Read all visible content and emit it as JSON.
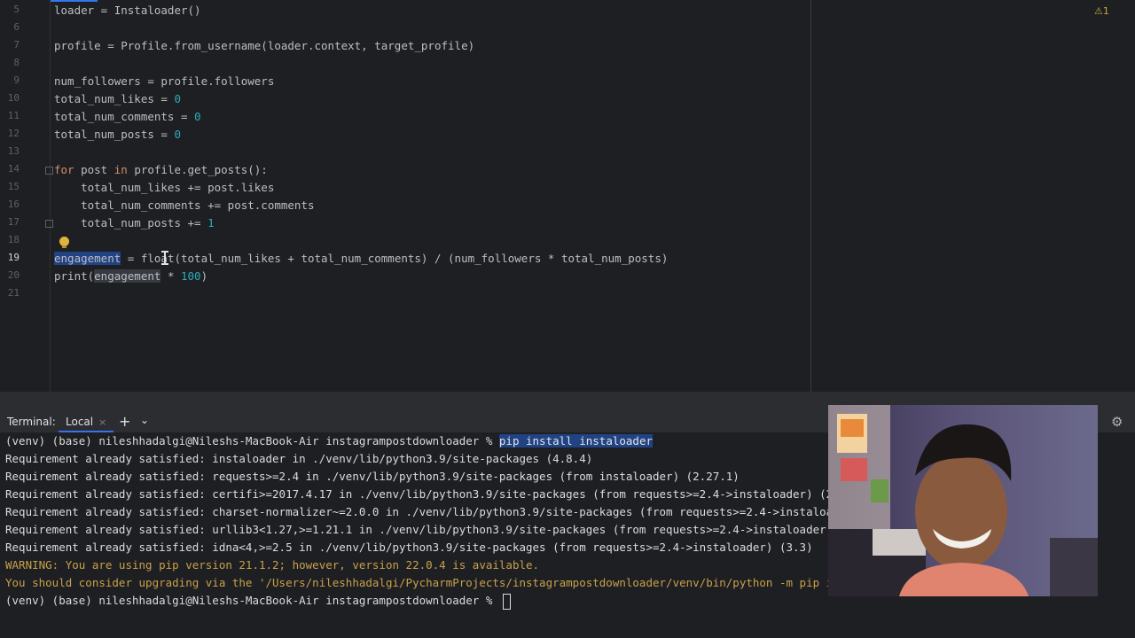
{
  "editor": {
    "inspection_badge": "⚠1",
    "gutter_lines": [
      "5",
      "6",
      "7",
      "8",
      "9",
      "10",
      "11",
      "12",
      "13",
      "14",
      "15",
      "16",
      "17",
      "18",
      "19",
      "20",
      "21"
    ],
    "code": {
      "l5": "loader = Instaloader()",
      "l7": "profile = Profile.from_username(loader.context, target_profile)",
      "l9": "num_followers = profile.followers",
      "l10a": "total_num_likes = ",
      "l10b": "0",
      "l11a": "total_num_comments = ",
      "l11b": "0",
      "l12a": "total_num_posts = ",
      "l12b": "0",
      "l14_for": "for",
      "l14_post": " post ",
      "l14_in": "in",
      "l14_rest": " profile.get_posts():",
      "l15": "    total_num_likes += post.likes",
      "l16": "    total_num_comments += post.comments",
      "l17a": "    total_num_posts += ",
      "l17b": "1",
      "l19_sel": "engagement",
      "l19_rest": " = float(total_num_likes + total_num_comments) / (num_followers * total_num_posts)",
      "l20a": "print(",
      "l20b": "engagement",
      "l20c": " * ",
      "l20d": "100",
      "l20e": ")"
    }
  },
  "terminal": {
    "title": "Terminal:",
    "tab_label": "Local",
    "tab_close": "×",
    "add_icon": "+",
    "dropdown_icon": "⌄",
    "settings_icon": "⚙",
    "prompt1": "(venv) (base) nileshhadalgi@Nileshs-MacBook-Air instagrampostdownloader % ",
    "command": "pip install instaloader",
    "lines": [
      "Requirement already satisfied: instaloader in ./venv/lib/python3.9/site-packages (4.8.4)",
      "Requirement already satisfied: requests>=2.4 in ./venv/lib/python3.9/site-packages (from instaloader) (2.27.1)",
      "Requirement already satisfied: certifi>=2017.4.17 in ./venv/lib/python3.9/site-packages (from requests>=2.4->instaloader) (2021",
      "Requirement already satisfied: charset-normalizer~=2.0.0 in ./venv/lib/python3.9/site-packages (from requests>=2.4->instaloader",
      "Requirement already satisfied: urllib3<1.27,>=1.21.1 in ./venv/lib/python3.9/site-packages (from requests>=2.4->instaloader) (1",
      "Requirement already satisfied: idna<4,>=2.5 in ./venv/lib/python3.9/site-packages (from requests>=2.4->instaloader) (3.3)"
    ],
    "warnings": [
      "WARNING: You are using pip version 21.1.2; however, version 22.0.4 is available.",
      "You should consider upgrading via the '/Users/nileshhadalgi/PycharmProjects/instagrampostdownloader/venv/bin/python -m pip inst"
    ],
    "prompt2": "(venv) (base) nileshhadalgi@Nileshs-MacBook-Air instagrampostdownloader % "
  },
  "colors": {
    "editor_bg": "#1e1f22",
    "keyword": "#cf8e6d",
    "number": "#2aacb8",
    "selection": "#214283",
    "warning_text": "#c9a04a"
  }
}
